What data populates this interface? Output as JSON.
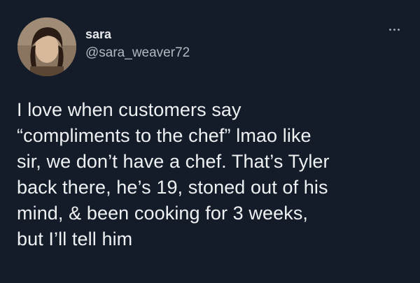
{
  "tweet": {
    "author": {
      "name": "sara",
      "handle": "@sara_weaver72",
      "avatar_icon": "profile-photo"
    },
    "more_icon": "more-options-icon",
    "text_lines": [
      "I love when customers say",
      "“compliments to the chef” lmao like",
      "sir, we don’t have a chef. That’s Tyler",
      "back there, he’s 19, stoned out of his",
      "mind, & been cooking for 3 weeks,",
      "but I’ll tell him"
    ]
  },
  "colors": {
    "background": "#141c2a",
    "text_primary": "#eef0f2",
    "text_secondary": "#b0b8c1"
  }
}
